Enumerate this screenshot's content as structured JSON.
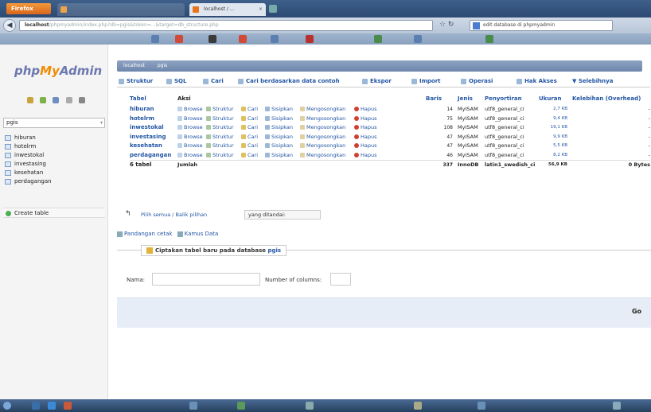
{
  "browser": {
    "firefox_label": "Firefox",
    "tabs": [
      {
        "label": ""
      },
      {
        "label": "localhost / ..."
      }
    ],
    "url_host": "localhost",
    "url_rest": "/phpmyadmin/index.php?db=pgis&token=...&target=db_structure.php",
    "search_text": "edit database di phpmyadmin"
  },
  "sidebar": {
    "logo_php": "php",
    "logo_my": "My",
    "logo_admin": "Admin",
    "db_selected": "pgis",
    "tables": [
      {
        "label": "hiburan"
      },
      {
        "label": "hotelrm"
      },
      {
        "label": "inwestokal"
      },
      {
        "label": "investasing"
      },
      {
        "label": "kesehatan"
      },
      {
        "label": "perdagangan"
      }
    ],
    "create_table": "Create table"
  },
  "main": {
    "breadcrumb": [
      "localhost",
      "pgis"
    ],
    "tabs": [
      {
        "label": "Struktur"
      },
      {
        "label": "SQL"
      },
      {
        "label": "Cari"
      },
      {
        "label": "Cari berdasarkan data contoh"
      },
      {
        "label": "Ekspor"
      },
      {
        "label": "Import"
      },
      {
        "label": "Operasi"
      },
      {
        "label": "Hak Akses"
      },
      {
        "label": "Selebihnya"
      }
    ],
    "columns": {
      "tabel": "Tabel",
      "aksi": "Aksi",
      "baris": "Baris",
      "jenis": "Jenis",
      "penyortiran": "Penyortiran",
      "ukuran": "Ukuran",
      "kelebihan": "Kelebihan (Overhead)"
    },
    "actions": {
      "browse": "Browse",
      "struktur": "Struktur",
      "cari": "Cari",
      "sisipkan": "Sisipkan",
      "mengosongkan": "Mengosongkan",
      "hapus": "Hapus"
    },
    "rows": [
      {
        "name": "hiburan",
        "baris": "14",
        "jenis": "MyISAM",
        "penyortiran": "utf8_general_ci",
        "ukuran": "2,7 KB",
        "overhead": "-"
      },
      {
        "name": "hotelrm",
        "baris": "75",
        "jenis": "MyISAM",
        "penyortiran": "utf8_general_ci",
        "ukuran": "9,4 KB",
        "overhead": "-"
      },
      {
        "name": "inwestokal",
        "baris": "108",
        "jenis": "MyISAM",
        "penyortiran": "utf8_general_ci",
        "ukuran": "19,1 KB",
        "overhead": "-"
      },
      {
        "name": "investasing",
        "baris": "47",
        "jenis": "MyISAM",
        "penyortiran": "utf8_general_ci",
        "ukuran": "9,9 KB",
        "overhead": "-"
      },
      {
        "name": "kesehatan",
        "baris": "47",
        "jenis": "MyISAM",
        "penyortiran": "utf8_general_ci",
        "ukuran": "5,5 KB",
        "overhead": "-"
      },
      {
        "name": "perdagangan",
        "baris": "46",
        "jenis": "MyISAM",
        "penyortiran": "utf8_general_ci",
        "ukuran": "8,2 KB",
        "overhead": "-"
      }
    ],
    "total": {
      "name": "6 tabel",
      "label": "Jumlah",
      "baris": "337",
      "jenis": "InnoDB",
      "penyortiran": "latin1_swedish_ci",
      "ukuran": "56,9 KB",
      "overhead": "0 Bytes"
    },
    "with_selected": {
      "link": "Pilih semua / Balik pilihan",
      "select_value": "yang ditandai:"
    },
    "print_view": "Pandangan cetak",
    "data_dictionary": "Kamus Data",
    "create_legend_prefix": "Ciptakan tabel baru pada database",
    "create_legend_db": "pgis",
    "name_label": "Nama:",
    "columns_label": "Number of columns:",
    "go_label": "Go"
  },
  "colors": {
    "link": "#2255a4",
    "logo_orange": "#f28b00",
    "logo_blue": "#6c78af",
    "breadcrumb": "#7a90b6"
  }
}
